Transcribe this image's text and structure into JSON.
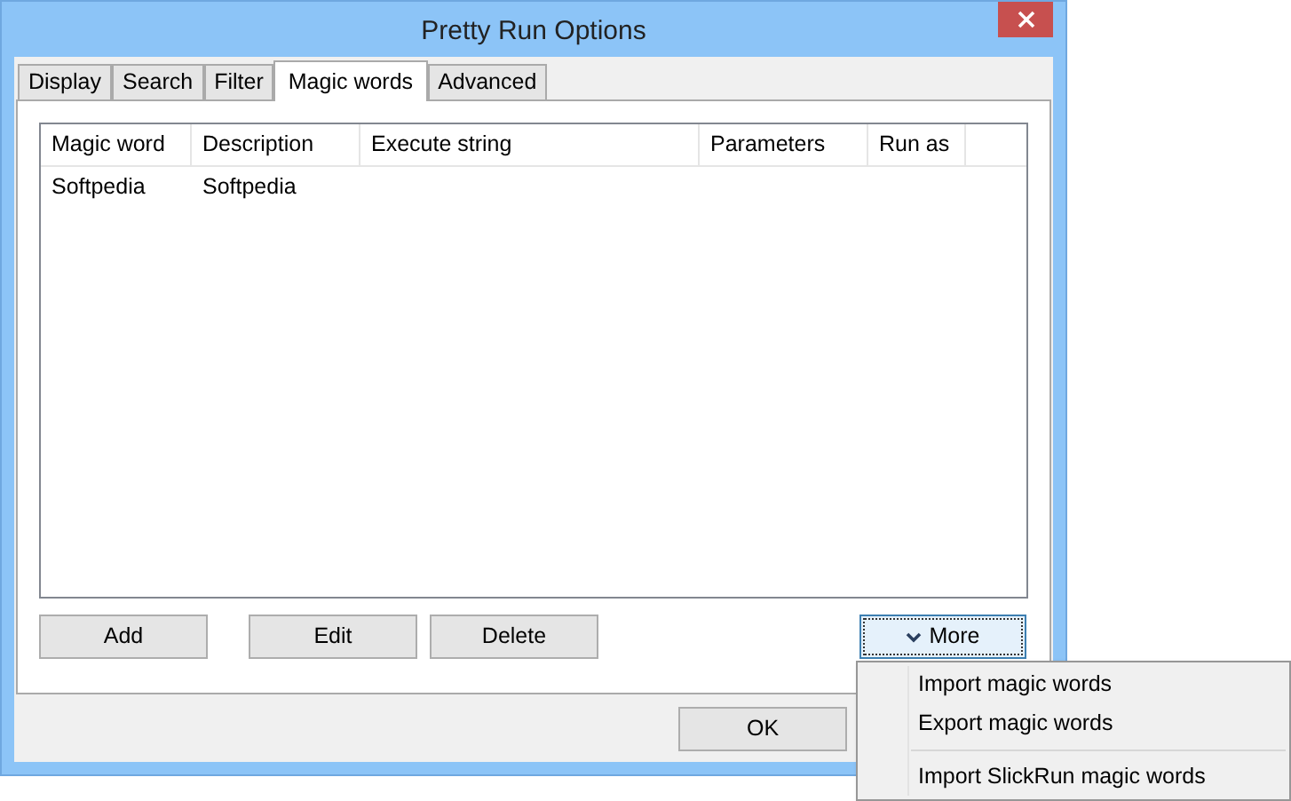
{
  "window": {
    "title": "Pretty Run Options"
  },
  "tabs": [
    {
      "label": "Display",
      "selected": false
    },
    {
      "label": "Search",
      "selected": false
    },
    {
      "label": "Filter",
      "selected": false
    },
    {
      "label": "Magic words",
      "selected": true
    },
    {
      "label": "Advanced",
      "selected": false
    }
  ],
  "table": {
    "columns": [
      "Magic word",
      "Description",
      "Execute string",
      "Parameters",
      "Run as"
    ],
    "rows": [
      [
        "Softpedia",
        "Softpedia",
        "",
        "",
        ""
      ]
    ]
  },
  "buttons": [
    "Add",
    "Edit",
    "Delete"
  ],
  "more_button": {
    "label": "More"
  },
  "footer_buttons": [
    "OK"
  ],
  "menu": {
    "items": [
      {
        "kind": "item",
        "label": "Import magic words"
      },
      {
        "kind": "item",
        "label": "Export magic words"
      },
      {
        "kind": "separator"
      },
      {
        "kind": "item",
        "label": "Import SlickRun magic words"
      }
    ]
  }
}
